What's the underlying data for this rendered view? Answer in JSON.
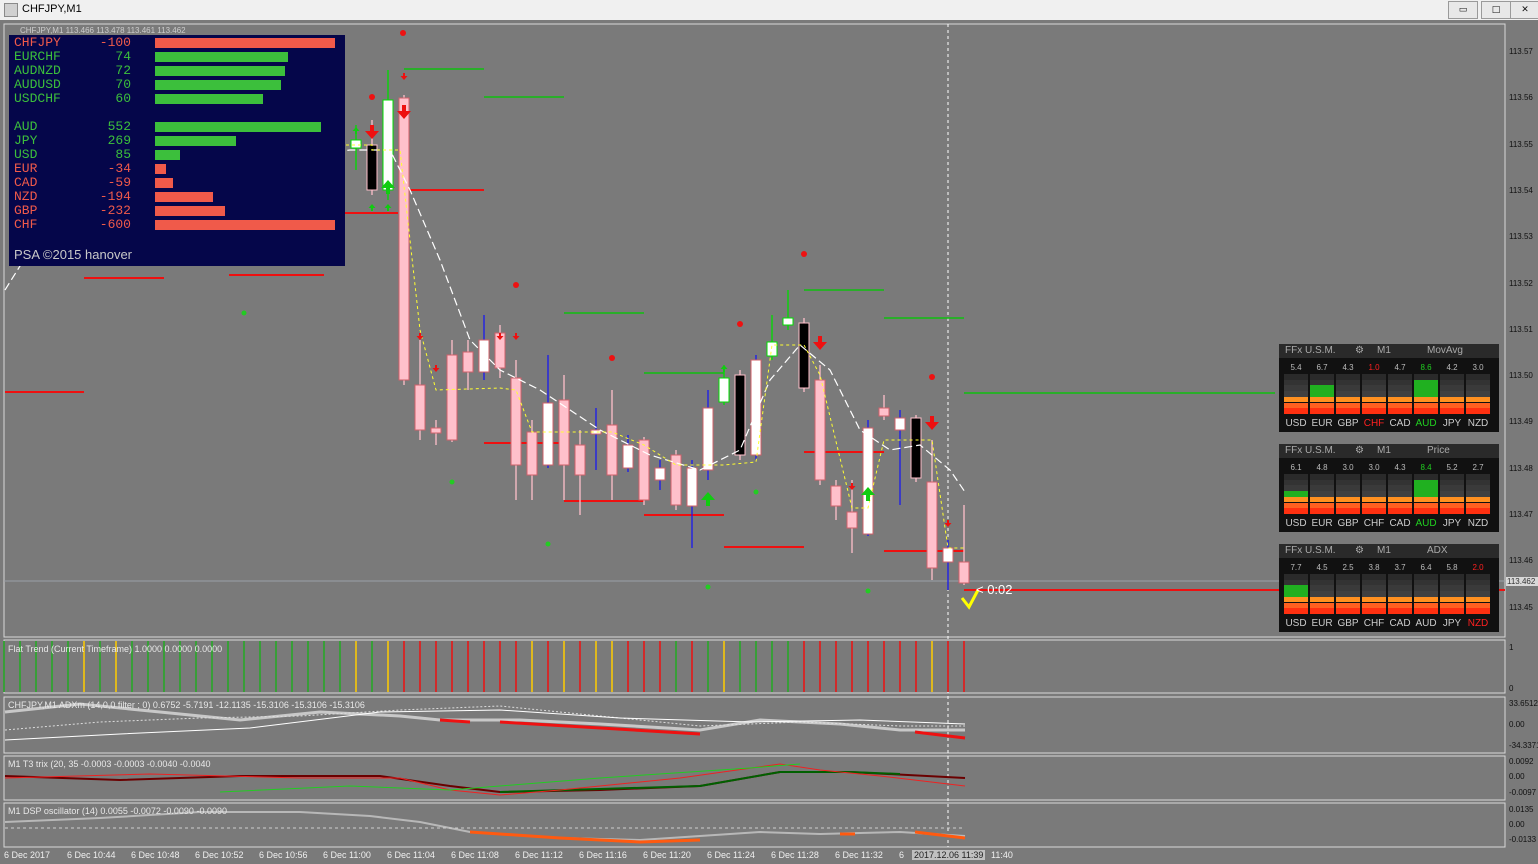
{
  "window": {
    "title": "CHFJPY,M1",
    "minimize": "▭",
    "maximize": "□",
    "close": "✕"
  },
  "chart_header": "CHFJPY,M1  113.466 113.478 113.461 113.462",
  "strength_meter": {
    "pairs": [
      {
        "sym": "CHFJPY",
        "val": "-100",
        "level": 100,
        "color": "#f05a4a"
      },
      {
        "sym": "EURCHF",
        "val": "74",
        "level": 74,
        "color": "#3cbf3c"
      },
      {
        "sym": "AUDNZD",
        "val": "72",
        "level": 72,
        "color": "#3cbf3c"
      },
      {
        "sym": "AUDUSD",
        "val": "70",
        "level": 70,
        "color": "#3cbf3c"
      },
      {
        "sym": "USDCHF",
        "val": "60",
        "level": 60,
        "color": "#3cbf3c"
      }
    ],
    "currencies": [
      {
        "sym": "AUD",
        "val": "552",
        "level": 92,
        "color": "#3cbf3c"
      },
      {
        "sym": "JPY",
        "val": "269",
        "level": 45,
        "color": "#3cbf3c"
      },
      {
        "sym": "USD",
        "val": "85",
        "level": 14,
        "color": "#3cbf3c"
      },
      {
        "sym": "EUR",
        "val": "-34",
        "level": 6,
        "color": "#f05a4a"
      },
      {
        "sym": "CAD",
        "val": "-59",
        "level": 10,
        "color": "#f05a4a"
      },
      {
        "sym": "NZD",
        "val": "-194",
        "level": 32,
        "color": "#f05a4a"
      },
      {
        "sym": "GBP",
        "val": "-232",
        "level": 39,
        "color": "#f05a4a"
      },
      {
        "sym": "CHF",
        "val": "-600",
        "level": 100,
        "color": "#f05a4a"
      }
    ],
    "footer": "PSA ©2015 hanover"
  },
  "usm_panels": [
    {
      "title": "FFx U.S.M.",
      "tf": "M1",
      "mode": "MovAvg",
      "nums": [
        "5.4",
        "6.7",
        "4.3",
        "1.0",
        "4.7",
        "8.6",
        "4.2",
        "3.0"
      ],
      "highlight_num": [
        3,
        5
      ],
      "currencies": [
        "USD",
        "EUR",
        "GBP",
        "CHF",
        "CAD",
        "AUD",
        "JPY",
        "NZD"
      ],
      "hi_cur": {
        "3": "#ff2020",
        "5": "#20d020"
      },
      "greens": [
        3,
        5,
        3,
        0,
        3,
        6,
        3,
        2
      ]
    },
    {
      "title": "FFx U.S.M.",
      "tf": "M1",
      "mode": "Price",
      "nums": [
        "6.1",
        "4.8",
        "3.0",
        "3.0",
        "4.3",
        "8.4",
        "5.2",
        "2.7"
      ],
      "highlight_num": [
        5
      ],
      "currencies": [
        "USD",
        "EUR",
        "GBP",
        "CHF",
        "CAD",
        "AUD",
        "JPY",
        "NZD"
      ],
      "hi_cur": {
        "5": "#20d020"
      },
      "greens": [
        4,
        3,
        1,
        1,
        2,
        6,
        3,
        1
      ]
    },
    {
      "title": "FFx U.S.M.",
      "tf": "M1",
      "mode": "ADX",
      "nums": [
        "7.7",
        "4.5",
        "2.5",
        "3.8",
        "3.7",
        "6.4",
        "5.8",
        "2.0"
      ],
      "highlight_num": [
        7
      ],
      "currencies": [
        "USD",
        "EUR",
        "GBP",
        "CHF",
        "CAD",
        "AUD",
        "JPY",
        "NZD"
      ],
      "hi_cur": {
        "7": "#ff2020"
      },
      "greens": [
        5,
        2,
        1,
        1,
        1,
        3,
        2,
        0
      ]
    }
  ],
  "price_axis": [
    "113.57",
    "113.56",
    "113.55",
    "113.54",
    "113.53",
    "113.52",
    "113.51",
    "113.50",
    "113.49",
    "113.48",
    "113.47",
    "113.46",
    "113.45"
  ],
  "current_price": "113.462",
  "countdown": "< 0:02",
  "subwindows": {
    "flat": {
      "label": "Flat Trend (Current Timeframe) 1.0000 0.0000 0.0000",
      "max": "1",
      "min": "0"
    },
    "adx": {
      "label": "CHFJPY,M1 ADXm (14,0,0 filter ; 0) 0.6752 -5.7191 -12.1135 -15.3106 -15.3106 -15.3106",
      "top": "33.6512",
      "mid": "0.00",
      "bot": "-34.3371"
    },
    "trix": {
      "label": "M1 T3 trix (20, 35 -0.0003 -0.0003 -0.0040 -0.0040",
      "top": "0.0092",
      "mid": "0.00",
      "bot": "-0.0097"
    },
    "dsp": {
      "label": "M1 DSP oscillator (14) 0.0055 -0.0072 -0.0090 -0.0090",
      "top": "0.0135",
      "mid": "0.00",
      "bot": "-0.0133"
    }
  },
  "time_axis": [
    "6 Dec 2017",
    "6 Dec 10:44",
    "6 Dec 10:48",
    "6 Dec 10:52",
    "6 Dec 10:56",
    "6 Dec 11:00",
    "6 Dec 11:04",
    "6 Dec 11:08",
    "6 Dec 11:12",
    "6 Dec 11:16",
    "6 Dec 11:20",
    "6 Dec 11:24",
    "6 Dec 11:28",
    "6 Dec 11:32",
    "6",
    "2017.12.06 11:39",
    "11:40"
  ],
  "colors": {
    "bg": "#7a7a7a",
    "bull": "#ffffff",
    "bear_pink": "#ffc0cb",
    "bear_black": "#000000",
    "signal_red": "#ff0000",
    "signal_green": "#00cc00"
  }
}
